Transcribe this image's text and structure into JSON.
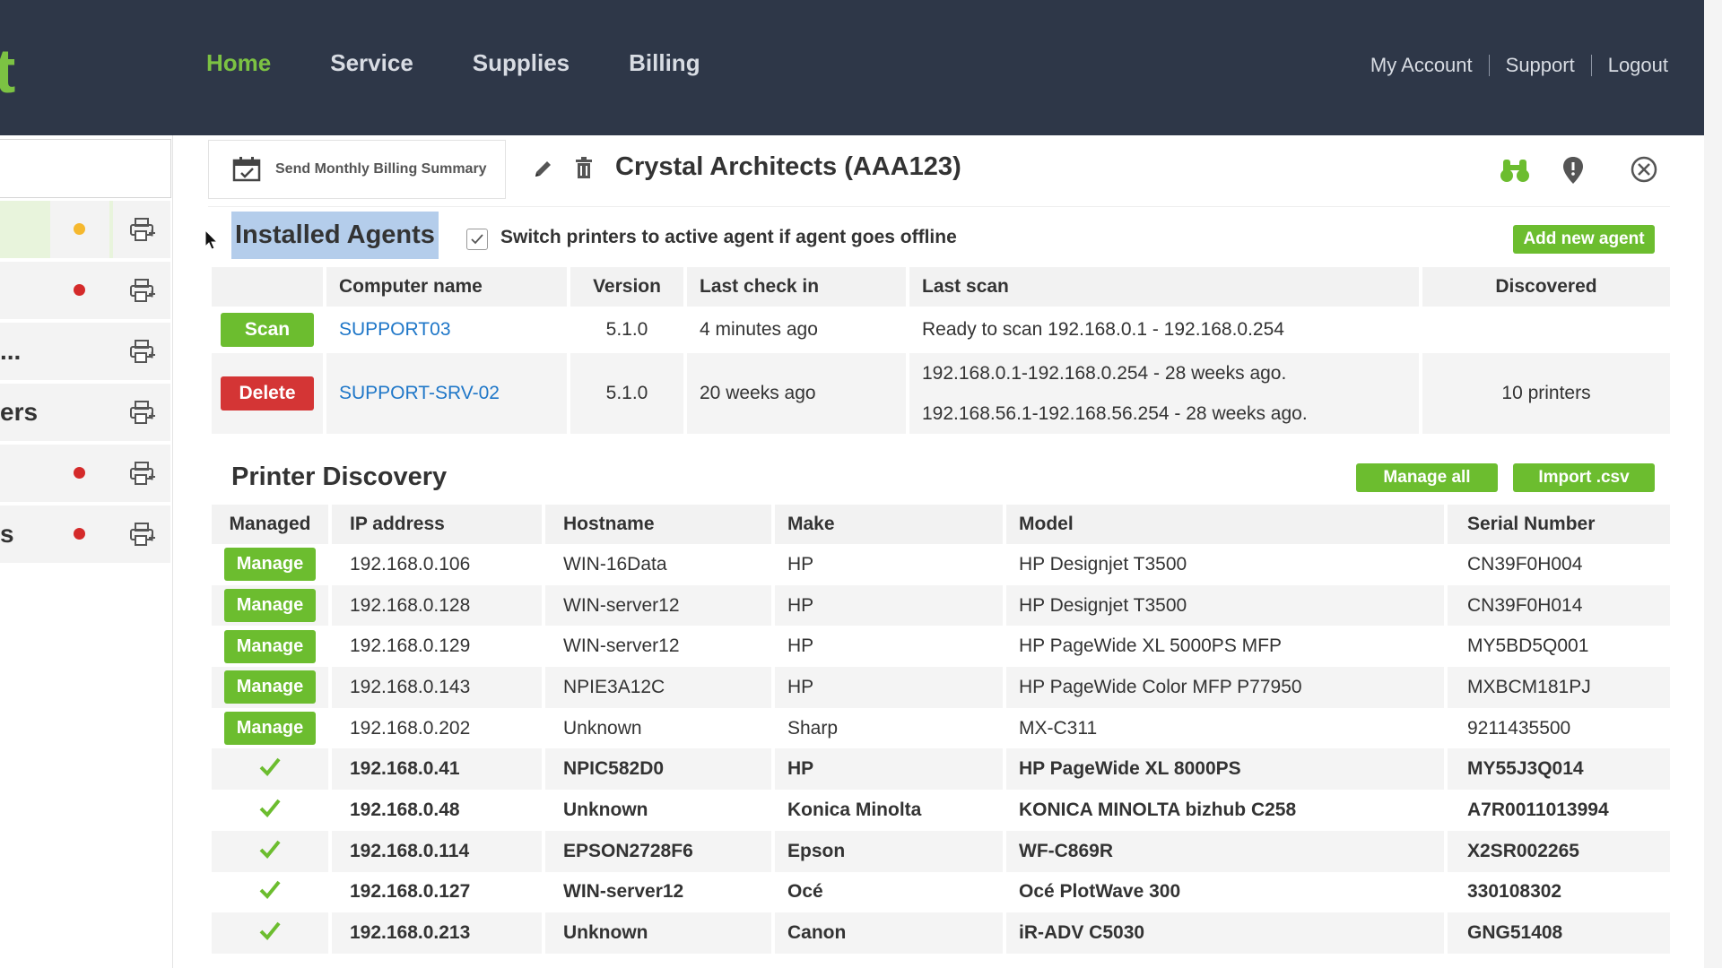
{
  "topnav": {
    "logo_fragment": "t",
    "items": [
      {
        "label": "Home",
        "active": true
      },
      {
        "label": "Service",
        "active": false
      },
      {
        "label": "Supplies",
        "active": false
      },
      {
        "label": "Billing",
        "active": false
      }
    ],
    "user_links": [
      "My Account",
      "Support",
      "Logout"
    ]
  },
  "sidebar": {
    "rows": [
      {
        "text": "",
        "dot": "#f5b82e",
        "icon": "printer-add-icon"
      },
      {
        "text": "",
        "dot": "#d42a2a",
        "icon": "printer-add-icon"
      },
      {
        "text": "...",
        "dot": null,
        "icon": "printer-add-icon"
      },
      {
        "text": "ers",
        "dot": null,
        "icon": "printer-add-icon"
      },
      {
        "text": "",
        "dot": "#d42a2a",
        "icon": "printer-add-icon"
      },
      {
        "text": "s",
        "dot": "#d42a2a",
        "icon": "printer-add-icon"
      }
    ]
  },
  "header": {
    "billing_button": "Send Monthly Billing Summary",
    "customer_title": "Crystal Architects (AAA123)",
    "icons": [
      "calendar-icon",
      "edit-icon",
      "trash-icon",
      "binoculars-icon",
      "location-pin-icon",
      "close-icon"
    ]
  },
  "agents": {
    "title": "Installed Agents",
    "checkbox_label": "Switch printers to active agent if agent goes offline",
    "checkbox_checked": true,
    "add_button": "Add new agent",
    "columns": [
      "",
      "Computer name",
      "Version",
      "Last check in",
      "Last scan",
      "Discovered"
    ],
    "rows": [
      {
        "action": "Scan",
        "computer": "SUPPORT03",
        "version": "5.1.0",
        "last_check_in": "4 minutes ago",
        "last_scan": [
          "Ready to scan 192.168.0.1 - 192.168.0.254"
        ],
        "discovered": ""
      },
      {
        "action": "Delete",
        "computer": "SUPPORT-SRV-02",
        "version": "5.1.0",
        "last_check_in": "20 weeks ago",
        "last_scan": [
          "192.168.0.1-192.168.0.254 - 28 weeks ago.",
          "192.168.56.1-192.168.56.254 - 28 weeks ago."
        ],
        "discovered": "10 printers"
      }
    ]
  },
  "discovery": {
    "title": "Printer Discovery",
    "manage_all_button": "Manage all",
    "import_button": "Import .csv",
    "columns": [
      "Managed",
      "IP address",
      "Hostname",
      "Make",
      "Model",
      "Serial Number"
    ],
    "manage_label": "Manage",
    "rows": [
      {
        "managed": false,
        "ip": "192.168.0.106",
        "host": "WIN-16Data",
        "make": "HP",
        "model": "HP Designjet T3500",
        "serial": "CN39F0H004"
      },
      {
        "managed": false,
        "ip": "192.168.0.128",
        "host": "WIN-server12",
        "make": "HP",
        "model": "HP Designjet T3500",
        "serial": "CN39F0H014"
      },
      {
        "managed": false,
        "ip": "192.168.0.129",
        "host": "WIN-server12",
        "make": "HP",
        "model": "HP PageWide XL 5000PS MFP",
        "serial": "MY5BD5Q001"
      },
      {
        "managed": false,
        "ip": "192.168.0.143",
        "host": "NPIE3A12C",
        "make": "HP",
        "model": "HP PageWide Color MFP P77950",
        "serial": "MXBCM181PJ"
      },
      {
        "managed": false,
        "ip": "192.168.0.202",
        "host": "Unknown",
        "make": "Sharp",
        "model": "MX-C311",
        "serial": "9211435500"
      },
      {
        "managed": true,
        "ip": "192.168.0.41",
        "host": "NPIC582D0",
        "make": "HP",
        "model": "HP PageWide XL 8000PS",
        "serial": "MY55J3Q014"
      },
      {
        "managed": true,
        "ip": "192.168.0.48",
        "host": "Unknown",
        "make": "Konica Minolta",
        "model": "KONICA MINOLTA bizhub C258",
        "serial": "A7R0011013994"
      },
      {
        "managed": true,
        "ip": "192.168.0.114",
        "host": "EPSON2728F6",
        "make": "Epson",
        "model": "WF-C869R",
        "serial": "X2SR002265"
      },
      {
        "managed": true,
        "ip": "192.168.0.127",
        "host": "WIN-server12",
        "make": "Océ",
        "model": "Océ PlotWave 300",
        "serial": "330108302"
      },
      {
        "managed": true,
        "ip": "192.168.0.213",
        "host": "Unknown",
        "make": "Canon",
        "model": "iR-ADV C5030",
        "serial": "GNG51408"
      }
    ]
  },
  "colors": {
    "accent_green": "#6cbd2f",
    "danger_red": "#d43535",
    "nav_bg": "#2e3748",
    "link_blue": "#1f77c8",
    "selection": "#b4cdeb"
  }
}
